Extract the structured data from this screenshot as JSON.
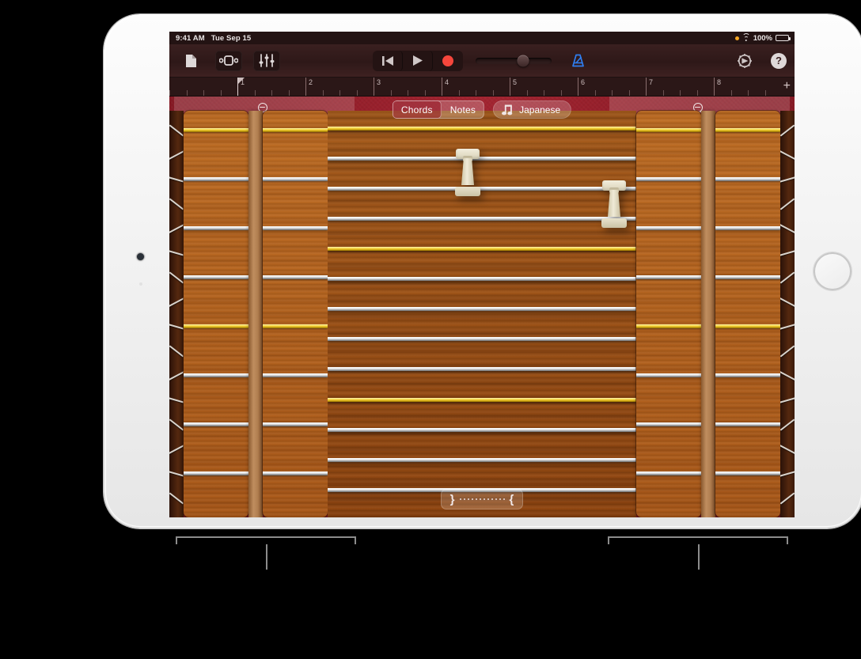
{
  "status_bar": {
    "time": "9:41 AM",
    "date": "Tue Sep 15",
    "battery_percent": "100%",
    "icons": [
      "orange-dot-icon",
      "wifi-icon",
      "battery-icon"
    ]
  },
  "toolbar": {
    "left_buttons": [
      {
        "name": "my-songs-button",
        "icon": "document-icon"
      },
      {
        "name": "track-view-button",
        "icon": "tracks-icon"
      },
      {
        "name": "mixer-button",
        "icon": "sliders-icon"
      }
    ],
    "transport": [
      {
        "name": "rewind-button",
        "icon": "rewind-icon"
      },
      {
        "name": "play-button",
        "icon": "play-icon"
      },
      {
        "name": "record-button",
        "icon": "record-icon",
        "color": "#f5463c"
      }
    ],
    "master_volume": {
      "name": "master-volume-slider",
      "value_percent": 62
    },
    "metronome": {
      "name": "metronome-button",
      "icon": "metronome-icon",
      "active": true,
      "color": "#2f7ef0"
    },
    "settings": {
      "name": "settings-button",
      "icon": "gear-icon"
    },
    "help": {
      "name": "help-button",
      "icon": "question-mark-icon",
      "label": "?"
    }
  },
  "ruler": {
    "bars": [
      "1",
      "2",
      "3",
      "4",
      "5",
      "6",
      "7",
      "8"
    ],
    "add_section_label": "+",
    "playhead_bar": "1"
  },
  "instrument": {
    "name": "koto",
    "left_zoom_button": {
      "name": "zoom-out-button-left",
      "icon": "magnifier-minus-icon"
    },
    "right_zoom_button": {
      "name": "zoom-out-button-right",
      "icon": "magnifier-minus-icon"
    },
    "segmented_control": {
      "name": "chords-notes-toggle",
      "options": [
        "Chords",
        "Notes"
      ],
      "selected": "Chords"
    },
    "scale_button": {
      "name": "scale-button",
      "label": "Japanese",
      "icon": "beamed-eighth-notes-icon"
    },
    "glissando_control": {
      "name": "glissando-control",
      "icon": "string-spacing-icon"
    },
    "strings": {
      "count": 13,
      "gold_indices": [
        1,
        5,
        10
      ],
      "bridge_count": 2
    },
    "left_zone_dividers": {
      "count": 8,
      "gold_indices": [
        1,
        5
      ]
    },
    "right_zone_dividers": {
      "count": 8,
      "gold_indices": [
        1,
        5
      ]
    }
  },
  "callouts": [
    {
      "name": "callout-left",
      "label": ""
    },
    {
      "name": "callout-right",
      "label": ""
    }
  ],
  "colors": {
    "felt_red": "#8e1c27",
    "wood": "#b4641f",
    "record_red": "#f5463c",
    "metronome_blue": "#2f7ef0",
    "string_white": "#efefef",
    "string_gold": "#f3d136"
  }
}
